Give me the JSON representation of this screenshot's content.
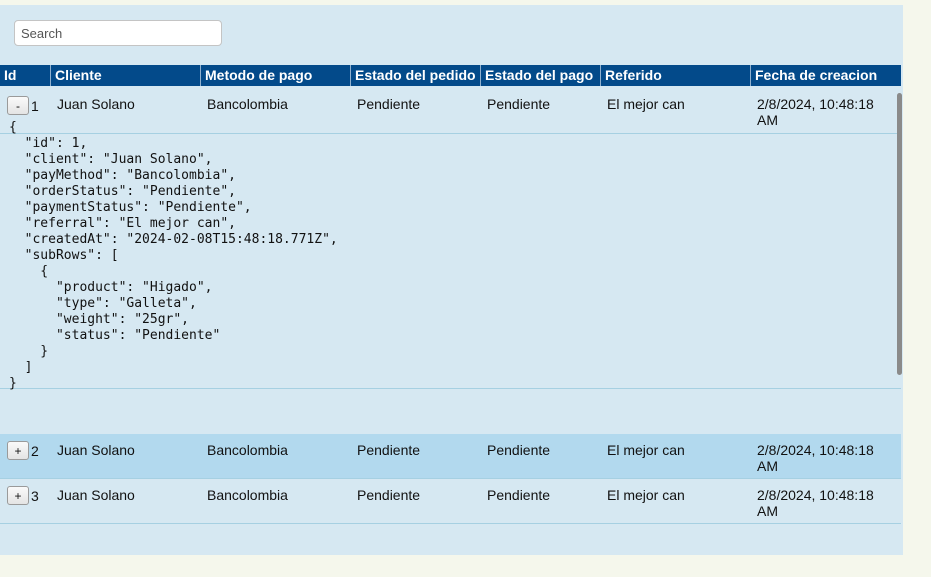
{
  "search": {
    "placeholder": "Search"
  },
  "table": {
    "columns": [
      "Id",
      "Cliente",
      "Metodo de pago",
      "Estado del pedido",
      "Estado del pago",
      "Referido",
      "Fecha de creacion"
    ],
    "rows": [
      {
        "toggle": "-",
        "id": "1",
        "client": "Juan Solano",
        "payMethod": "Bancolombia",
        "orderStatus": "Pendiente",
        "paymentStatus": "Pendiente",
        "referral": "El mejor can",
        "createdAt_line1": "2/8/2024, 10:48:18",
        "createdAt_line2": "AM",
        "expanded_json": "{\n  \"id\": 1,\n  \"client\": \"Juan Solano\",\n  \"payMethod\": \"Bancolombia\",\n  \"orderStatus\": \"Pendiente\",\n  \"paymentStatus\": \"Pendiente\",\n  \"referral\": \"El mejor can\",\n  \"createdAt\": \"2024-02-08T15:48:18.771Z\",\n  \"subRows\": [\n    {\n      \"product\": \"Higado\",\n      \"type\": \"Galleta\",\n      \"weight\": \"25gr\",\n      \"status\": \"Pendiente\"\n    }\n  ]\n}"
      },
      {
        "toggle": "+",
        "id": "2",
        "client": "Juan Solano",
        "payMethod": "Bancolombia",
        "orderStatus": "Pendiente",
        "paymentStatus": "Pendiente",
        "referral": "El mejor can",
        "createdAt_line1": "2/8/2024, 10:48:18",
        "createdAt_line2": "AM"
      },
      {
        "toggle": "+",
        "id": "3",
        "client": "Juan Solano",
        "payMethod": "Bancolombia",
        "orderStatus": "Pendiente",
        "paymentStatus": "Pendiente",
        "referral": "El mejor can",
        "createdAt_line1": "2/8/2024, 10:48:18",
        "createdAt_line2": "AM"
      }
    ]
  },
  "colors": {
    "header_bg": "#034a8a",
    "panel_bg": "#d6e8f2",
    "hover_row_bg": "#b2d9ee",
    "page_bg": "#f5f7ec"
  }
}
